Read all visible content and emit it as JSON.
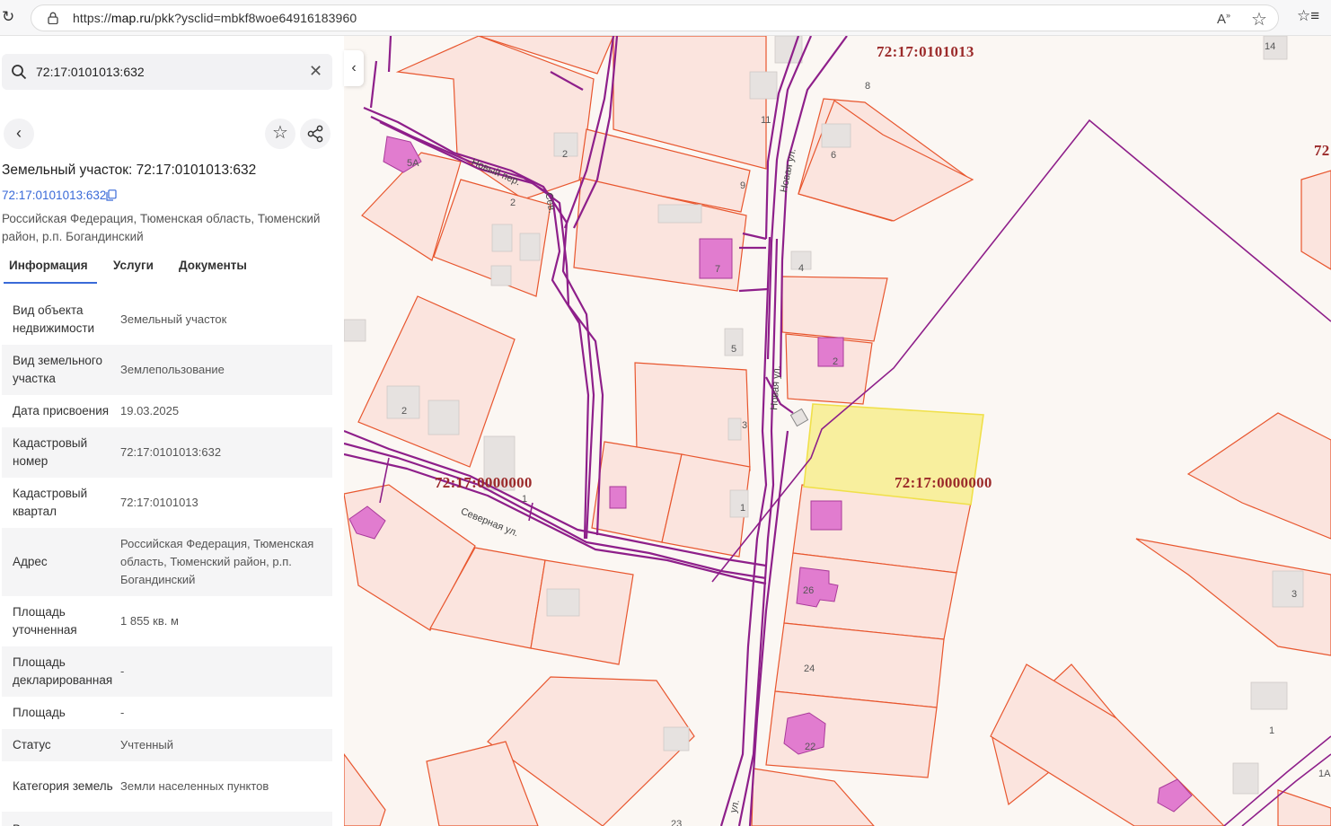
{
  "browser": {
    "url_prefix": "https://",
    "url_host": "map.ru",
    "url_path": "/pkk?ysclid=mbkf8woe64916183960"
  },
  "search": {
    "value": "72:17:0101013:632"
  },
  "object": {
    "title": "Земельный участок: 72:17:0101013:632",
    "cad_number_link": "72:17:0101013:632",
    "address": "Российская Федерация, Тюменская область, Тюменский район, р.п. Богандинский"
  },
  "tabs": [
    {
      "label": "Информация"
    },
    {
      "label": "Услуги"
    },
    {
      "label": "Документы"
    }
  ],
  "properties": [
    {
      "key": "Вид объекта недвижимости",
      "value": "Земельный участок"
    },
    {
      "key": "Вид земельного участка",
      "value": "Землепользование"
    },
    {
      "key": "Дата присвоения",
      "value": "19.03.2025"
    },
    {
      "key": "Кадастровый номер",
      "value": "72:17:0101013:632"
    },
    {
      "key": "Кадастровый квартал",
      "value": "72:17:0101013"
    },
    {
      "key": "Адрес",
      "value": "Российская Федерация, Тюменская область, Тюменский район, р.п. Богандинский"
    },
    {
      "key": "Площадь уточненная",
      "value": "1 855 кв. м"
    },
    {
      "key": "Площадь декларированная",
      "value": "-"
    },
    {
      "key": "Площадь",
      "value": "-"
    },
    {
      "key": "Статус",
      "value": "Учтенный"
    },
    {
      "key": "Категория земель",
      "value": "Земли населенных пунктов"
    },
    {
      "key": "В",
      "value": ""
    }
  ],
  "map": {
    "quarter_labels": [
      "72:17:0101013",
      "72:17:0000000",
      "72:17:0000000",
      "72"
    ],
    "house_numbers": [
      "14",
      "8",
      "11",
      "6",
      "2",
      "5А",
      "2",
      "9",
      "7",
      "4",
      "5",
      "2",
      "2",
      "3",
      "1",
      "1",
      "26",
      "24",
      "22",
      "3",
      "1",
      "1А",
      "23"
    ],
    "streets": [
      "Новый пер.",
      "Новая ул.",
      "Новая ул.",
      "Северная ул.",
      "Сев.",
      "ул."
    ],
    "colors": {
      "parcel_fill": "#fbe4de",
      "parcel_stroke": "#e8562e",
      "boundary": "#8e1f8a",
      "selected_fill": "#f8ef9e",
      "selected_stroke": "#f0e04a",
      "building_fill": "#e17ccf",
      "label": "#9b2a2a"
    }
  }
}
